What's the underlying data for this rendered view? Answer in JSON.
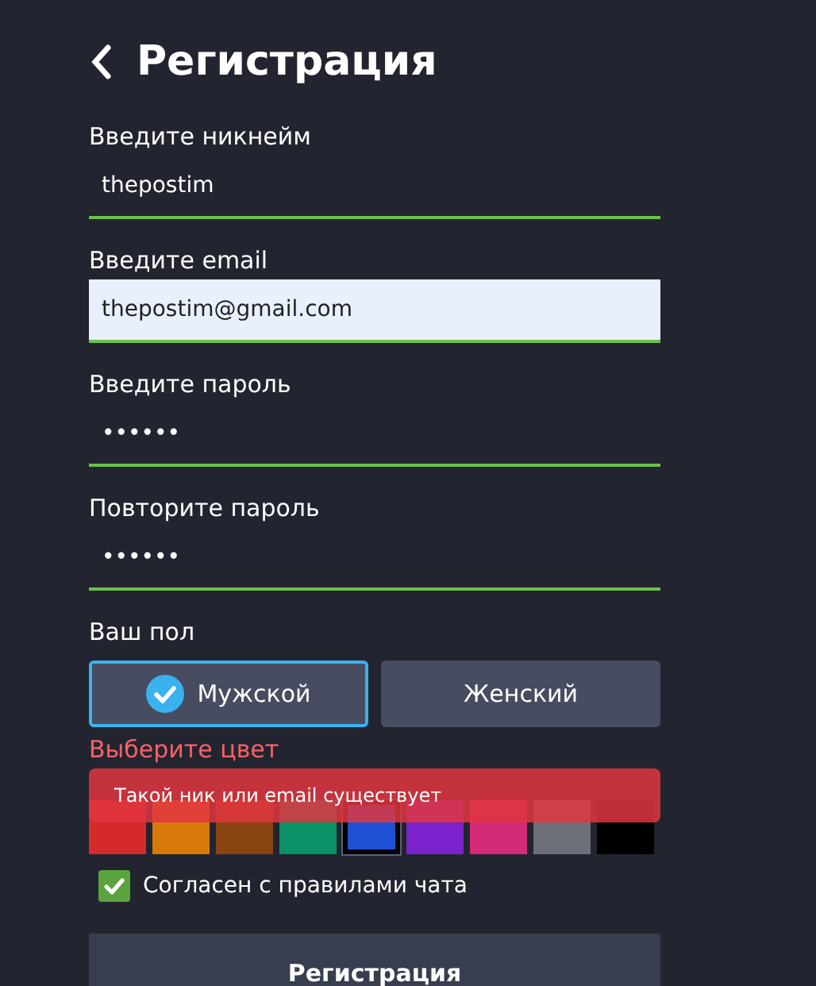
{
  "header": {
    "title": "Регистрация"
  },
  "fields": [
    {
      "label": "Введите никнейм",
      "value": "thepostim",
      "autofilled": false
    },
    {
      "label": "Введите email",
      "value": "thepostim@gmail.com",
      "autofilled": true
    },
    {
      "label": "Введите пароль",
      "value": "••••••",
      "autofilled": false
    },
    {
      "label": "Повторите пароль",
      "value": "••••••",
      "autofilled": false
    }
  ],
  "gender": {
    "label": "Ваш пол",
    "options": [
      {
        "label": "Мужской",
        "selected": true
      },
      {
        "label": "Женский",
        "selected": false
      }
    ]
  },
  "color_picker": {
    "label": "Выберите цвет",
    "swatches": [
      {
        "color": "#d42a2a",
        "selected": false
      },
      {
        "color": "#d9790a",
        "selected": false
      },
      {
        "color": "#8b4513",
        "selected": false
      },
      {
        "color": "#0a9168",
        "selected": false
      },
      {
        "color": "#1e50d4",
        "selected": true
      },
      {
        "color": "#7b22cc",
        "selected": false
      },
      {
        "color": "#d42a78",
        "selected": false
      },
      {
        "color": "#6e7079",
        "selected": false
      },
      {
        "color": "#000000",
        "selected": false
      }
    ]
  },
  "error_toast": {
    "text": "Такой ник или email существует"
  },
  "agree": {
    "label": "Согласен с правилами чата",
    "checked": true
  },
  "submit": {
    "label": "Регистрация"
  }
}
